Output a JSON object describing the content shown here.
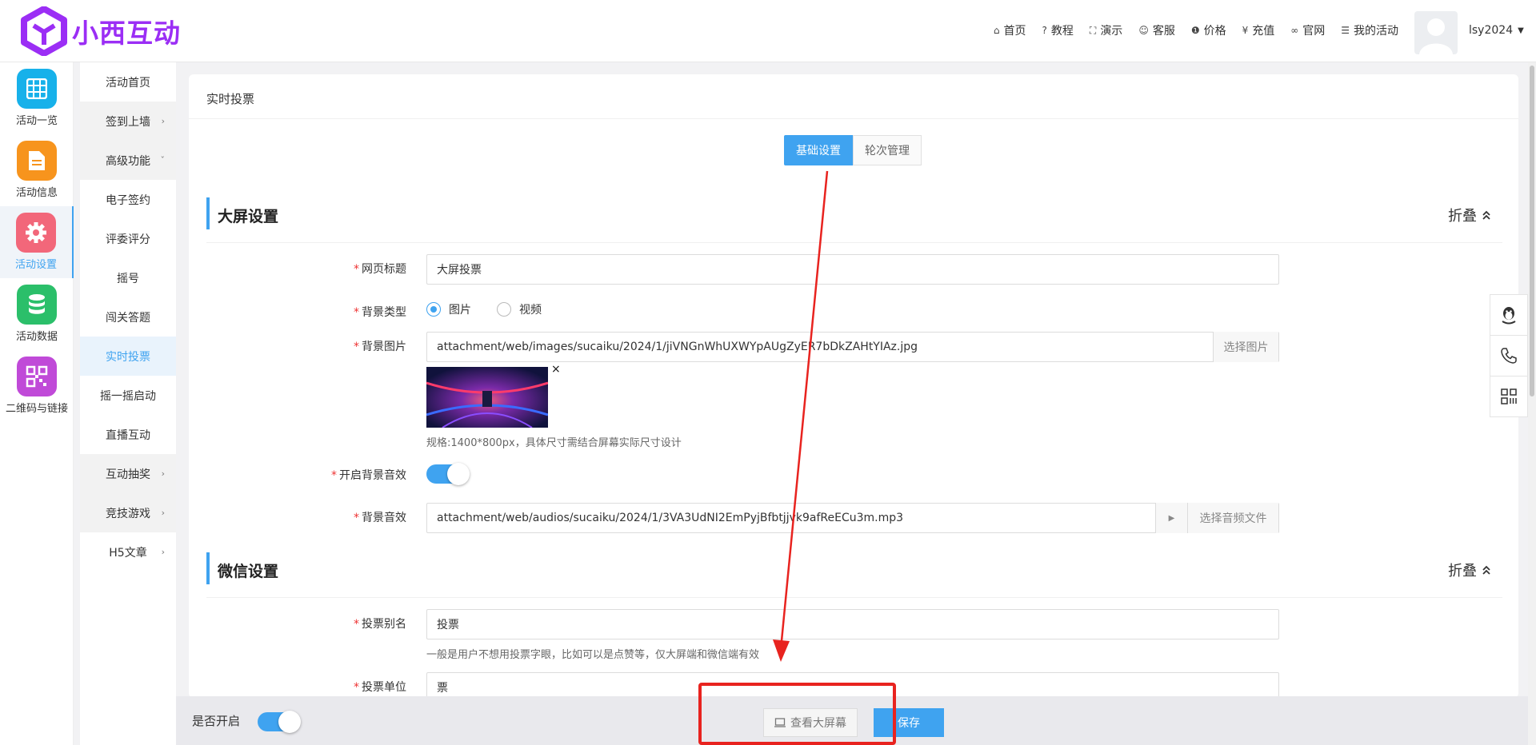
{
  "brand": {
    "name": "小西互动",
    "color": "#9b2ef5"
  },
  "topnav": [
    {
      "icon": "home-icon",
      "glyph": "⌂",
      "label": "首页"
    },
    {
      "icon": "help-icon",
      "glyph": "?",
      "label": "教程"
    },
    {
      "icon": "expand-icon",
      "glyph": "⛶",
      "label": "演示"
    },
    {
      "icon": "smile-icon",
      "glyph": "☺",
      "label": "客服"
    },
    {
      "icon": "info-icon",
      "glyph": "❶",
      "label": "价格"
    },
    {
      "icon": "yen-icon",
      "glyph": "¥",
      "label": "充值"
    },
    {
      "icon": "link-icon",
      "glyph": "∞",
      "label": "官网"
    },
    {
      "icon": "list-icon",
      "glyph": "☰",
      "label": "我的活动"
    }
  ],
  "user": {
    "name": "lsy2024"
  },
  "sidebar1": [
    {
      "label": "活动一览",
      "color": "#17b1ea",
      "icon": "grid-icon"
    },
    {
      "label": "活动信息",
      "color": "#f7941d",
      "icon": "document-icon"
    },
    {
      "label": "活动设置",
      "color": "#f2677a",
      "icon": "gear-icon",
      "active": true
    },
    {
      "label": "活动数据",
      "color": "#2bbf6a",
      "icon": "database-icon"
    },
    {
      "label": "二维码与链接",
      "color": "#c04ad8",
      "icon": "qrcode-icon"
    }
  ],
  "sidebar2": [
    {
      "label": "活动首页",
      "group": false,
      "arrow": ""
    },
    {
      "label": "签到上墙",
      "group": true,
      "arrow": "›"
    },
    {
      "label": "高级功能",
      "group": true,
      "arrow": "ˇ"
    },
    {
      "label": "电子签约",
      "group": false,
      "arrow": ""
    },
    {
      "label": "评委评分",
      "group": false,
      "arrow": ""
    },
    {
      "label": "摇号",
      "group": false,
      "arrow": ""
    },
    {
      "label": "闯关答题",
      "group": false,
      "arrow": ""
    },
    {
      "label": "实时投票",
      "group": false,
      "arrow": "",
      "active": true
    },
    {
      "label": "摇一摇启动",
      "group": false,
      "arrow": ""
    },
    {
      "label": "直播互动",
      "group": false,
      "arrow": ""
    },
    {
      "label": "互动抽奖",
      "group": true,
      "arrow": "›"
    },
    {
      "label": "竞技游戏",
      "group": true,
      "arrow": "›"
    },
    {
      "label": "H5文章",
      "group": false,
      "arrow": "›"
    }
  ],
  "card": {
    "title": "实时投票"
  },
  "tabs": {
    "basic": "基础设置",
    "rounds": "轮次管理"
  },
  "bigscreen": {
    "title": "大屏设置",
    "fold": "折叠",
    "required_mark": "*",
    "page_title_label": "网页标题",
    "page_title_value": "大屏投票",
    "bg_type_label": "背景类型",
    "bg_type_options": [
      "图片",
      "视频"
    ],
    "bg_type_selected": "图片",
    "bg_image_label": "背景图片",
    "bg_image_value": "attachment/web/images/sucaiku/2024/1/jiVNGnWhUXWYpAUgZyER7bDkZAHtYIAz.jpg",
    "bg_image_button": "选择图片",
    "bg_image_close": "×",
    "bg_image_hint": "规格:1400*800px，具体尺寸需结合屏幕实际尺寸设计",
    "bg_music_toggle_label": "开启背景音效",
    "bg_music_label": "背景音效",
    "bg_music_value": "attachment/web/audios/sucaiku/2024/1/3VA3UdNI2EmPyjBfbtjjvk9afReECu3m.mp3",
    "bg_music_play": "▶",
    "bg_music_button": "选择音频文件"
  },
  "wechat": {
    "title": "微信设置",
    "fold": "折叠",
    "vote_alias_label": "投票别名",
    "vote_alias_value": "投票",
    "vote_alias_hint": "一般是用户不想用投票字眼，比如可以是点赞等，仅大屏端和微信端有效",
    "vote_unit_label": "投票单位",
    "vote_unit_value": "票"
  },
  "bottombar": {
    "enable_label": "是否开启",
    "view_button": "查看大屏幕",
    "save_button": "保存"
  },
  "colors": {
    "accent": "#3fa3f0",
    "annotation": "#e8231f"
  }
}
